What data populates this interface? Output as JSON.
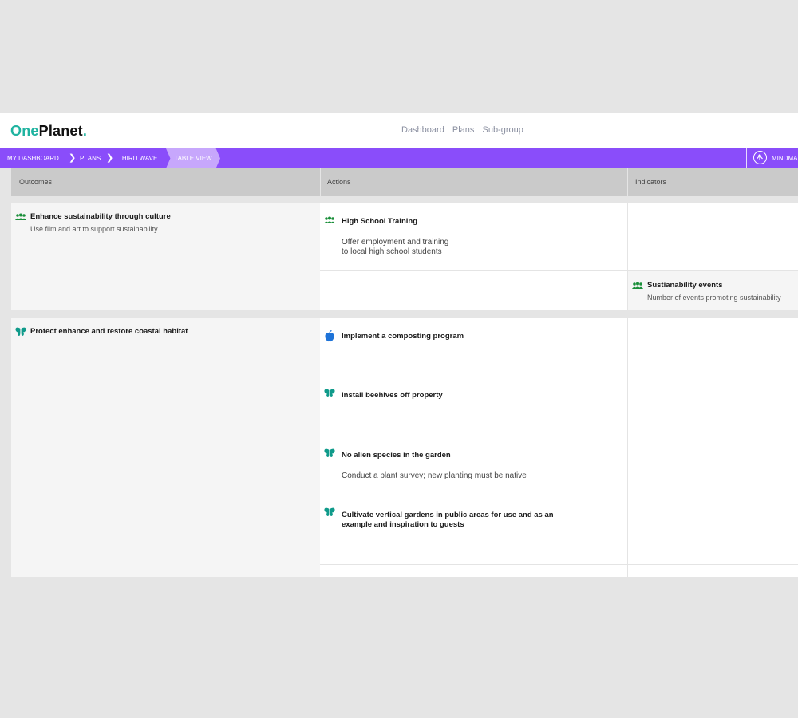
{
  "app": {
    "logo_one": "One",
    "logo_planet": "Planet",
    "logo_dot": "."
  },
  "topnav": [
    "Dashboard",
    "Plans",
    "Sub-group"
  ],
  "breadcrumb": {
    "items": [
      "MY DASHBOARD",
      "PLANS",
      "THIRD WAVE"
    ],
    "active": "TABLE VIEW",
    "mindmap_label": "MINDMA"
  },
  "table": {
    "headers": {
      "outcomes": "Outcomes",
      "actions": "Actions",
      "indicators": "Indicators"
    },
    "outcome1": {
      "title": "Enhance sustainability through culture",
      "subtitle": "Use film and art to support sustainability",
      "icon": "people-icon"
    },
    "action1": {
      "title": "High School Training",
      "desc_line1": "Offer employment and training",
      "desc_line2": "to local high school students",
      "icon": "people-icon"
    },
    "indicator1": {
      "title": "Sustianability events",
      "subtitle": "Number of events promoting sustainability",
      "icon": "people-icon"
    },
    "outcome2": {
      "title": "Protect enhance and restore coastal habitat",
      "icon": "butterfly-icon"
    },
    "actions2": [
      {
        "title": "Implement a composting program",
        "icon": "apple-icon"
      },
      {
        "title": "Install beehives off property",
        "icon": "butterfly-icon"
      },
      {
        "title": "No alien species in the garden",
        "desc": "Conduct a plant survey; new planting must be native",
        "icon": "butterfly-icon"
      },
      {
        "title_line1": "Cultivate vertical gardens in public areas for use and as an",
        "title_line2": "example and inspiration to guests",
        "icon": "butterfly-icon"
      }
    ]
  },
  "colors": {
    "accent": "#8a4dfa",
    "brand": "#1fb3a0",
    "people_icon": "#1a8f3a",
    "butterfly_icon": "#0f9a8a",
    "apple_icon": "#1e73d8"
  }
}
